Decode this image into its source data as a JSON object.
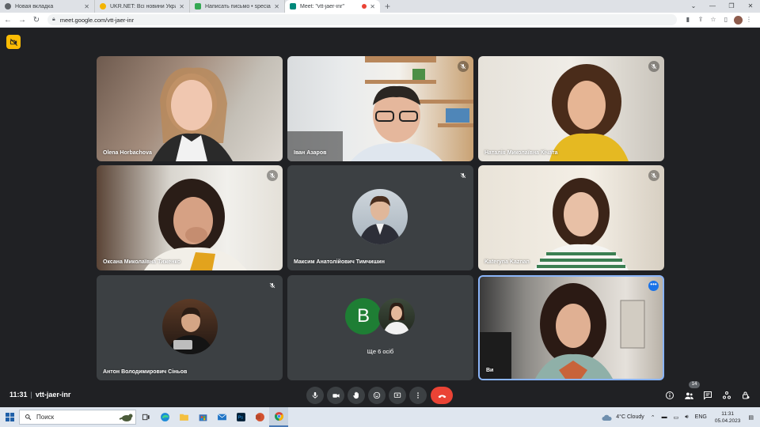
{
  "browser": {
    "tabs": [
      {
        "label": "Новая вкладка",
        "favicon_color": "#5f6368",
        "active": false
      },
      {
        "label": "UKR.NET: Всі новини України, о",
        "favicon_color": "#f4b400",
        "active": false
      },
      {
        "label": "Написать письмо • specially@u",
        "favicon_color": "#34a853",
        "active": false
      },
      {
        "label": "Meet: \"vtt-jaer-inr\"",
        "favicon_color": "#00897b",
        "active": true
      }
    ],
    "new_tab_label": "+",
    "url": "meet.google.com/vtt-jaer-inr"
  },
  "participants": [
    {
      "name": "Olena Horbachova",
      "muted": false,
      "kind": "video"
    },
    {
      "name": "Іван Азаров",
      "muted": true,
      "kind": "video"
    },
    {
      "name": "Наталія Миколаївна Кічата",
      "muted": true,
      "kind": "video"
    },
    {
      "name": "Оксана Миколаївна Тиженко",
      "muted": true,
      "kind": "video"
    },
    {
      "name": "Максим Анатолійович Тимчишин",
      "muted": true,
      "kind": "avatar"
    },
    {
      "name": "Kateryna Kaznan",
      "muted": true,
      "kind": "video"
    },
    {
      "name": "Антон Володимирович Сіньов",
      "muted": true,
      "kind": "avatar"
    },
    {
      "name": "Ще 6 осіб",
      "avatar_letter": "B",
      "kind": "group"
    },
    {
      "name": "Ви",
      "muted": false,
      "kind": "self"
    }
  ],
  "meeting": {
    "time": "11:31",
    "separator": "|",
    "code": "vtt-jaer-inr",
    "people_count": "14"
  },
  "colors": {
    "background": "#202124",
    "tile": "#3c4043",
    "end_call": "#ea4335",
    "self_border": "#8ab4f8",
    "badge_yellow": "#fbbc04"
  },
  "taskbar": {
    "search_placeholder": "Поиск",
    "weather": "4°C  Cloudy",
    "language": "ENG",
    "time": "11:31",
    "date": "05.04.2023"
  }
}
